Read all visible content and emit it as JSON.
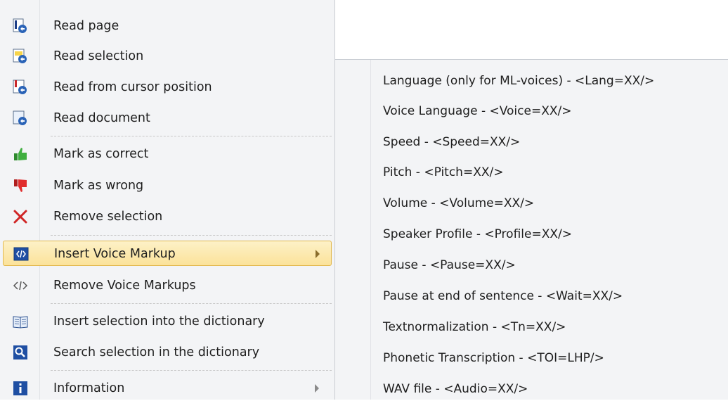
{
  "menu": {
    "items": [
      {
        "label": "Read page",
        "icon": "read-page-icon"
      },
      {
        "label": "Read selection",
        "icon": "read-selection-icon"
      },
      {
        "label": "Read from cursor position",
        "icon": "read-cursor-icon"
      },
      {
        "label": "Read document",
        "icon": "read-document-icon"
      },
      {
        "label": "Mark as correct",
        "icon": "thumbs-up-icon"
      },
      {
        "label": "Mark as wrong",
        "icon": "thumbs-down-icon"
      },
      {
        "label": "Remove selection",
        "icon": "remove-x-icon"
      },
      {
        "label": "Insert Voice Markup",
        "icon": "voice-markup-icon",
        "submenu": true,
        "active": true
      },
      {
        "label": "Remove Voice Markups",
        "icon": "code-tag-icon"
      },
      {
        "label": "Insert selection into the dictionary",
        "icon": "book-icon"
      },
      {
        "label": "Search selection in the dictionary",
        "icon": "search-icon"
      },
      {
        "label": "Information",
        "icon": "info-icon",
        "submenu": true
      }
    ]
  },
  "submenu": {
    "items": [
      "Language (only for ML-voices) - <Lang=XX/>",
      "Voice Language - <Voice=XX/>",
      "Speed - <Speed=XX/>",
      "Pitch - <Pitch=XX/>",
      "Volume - <Volume=XX/>",
      "Speaker Profile - <Profile=XX/>",
      "Pause - <Pause=XX/>",
      "Pause at end of sentence - <Wait=XX/>",
      "Textnormalization - <Tn=XX/>",
      "Phonetic Transcription - <TOI=LHP/>",
      "WAV file - <Audio=XX/>"
    ]
  },
  "colors": {
    "active_bg": "#fbe29a",
    "active_border": "#e2b84d",
    "menu_bg": "#f3f4f6"
  }
}
